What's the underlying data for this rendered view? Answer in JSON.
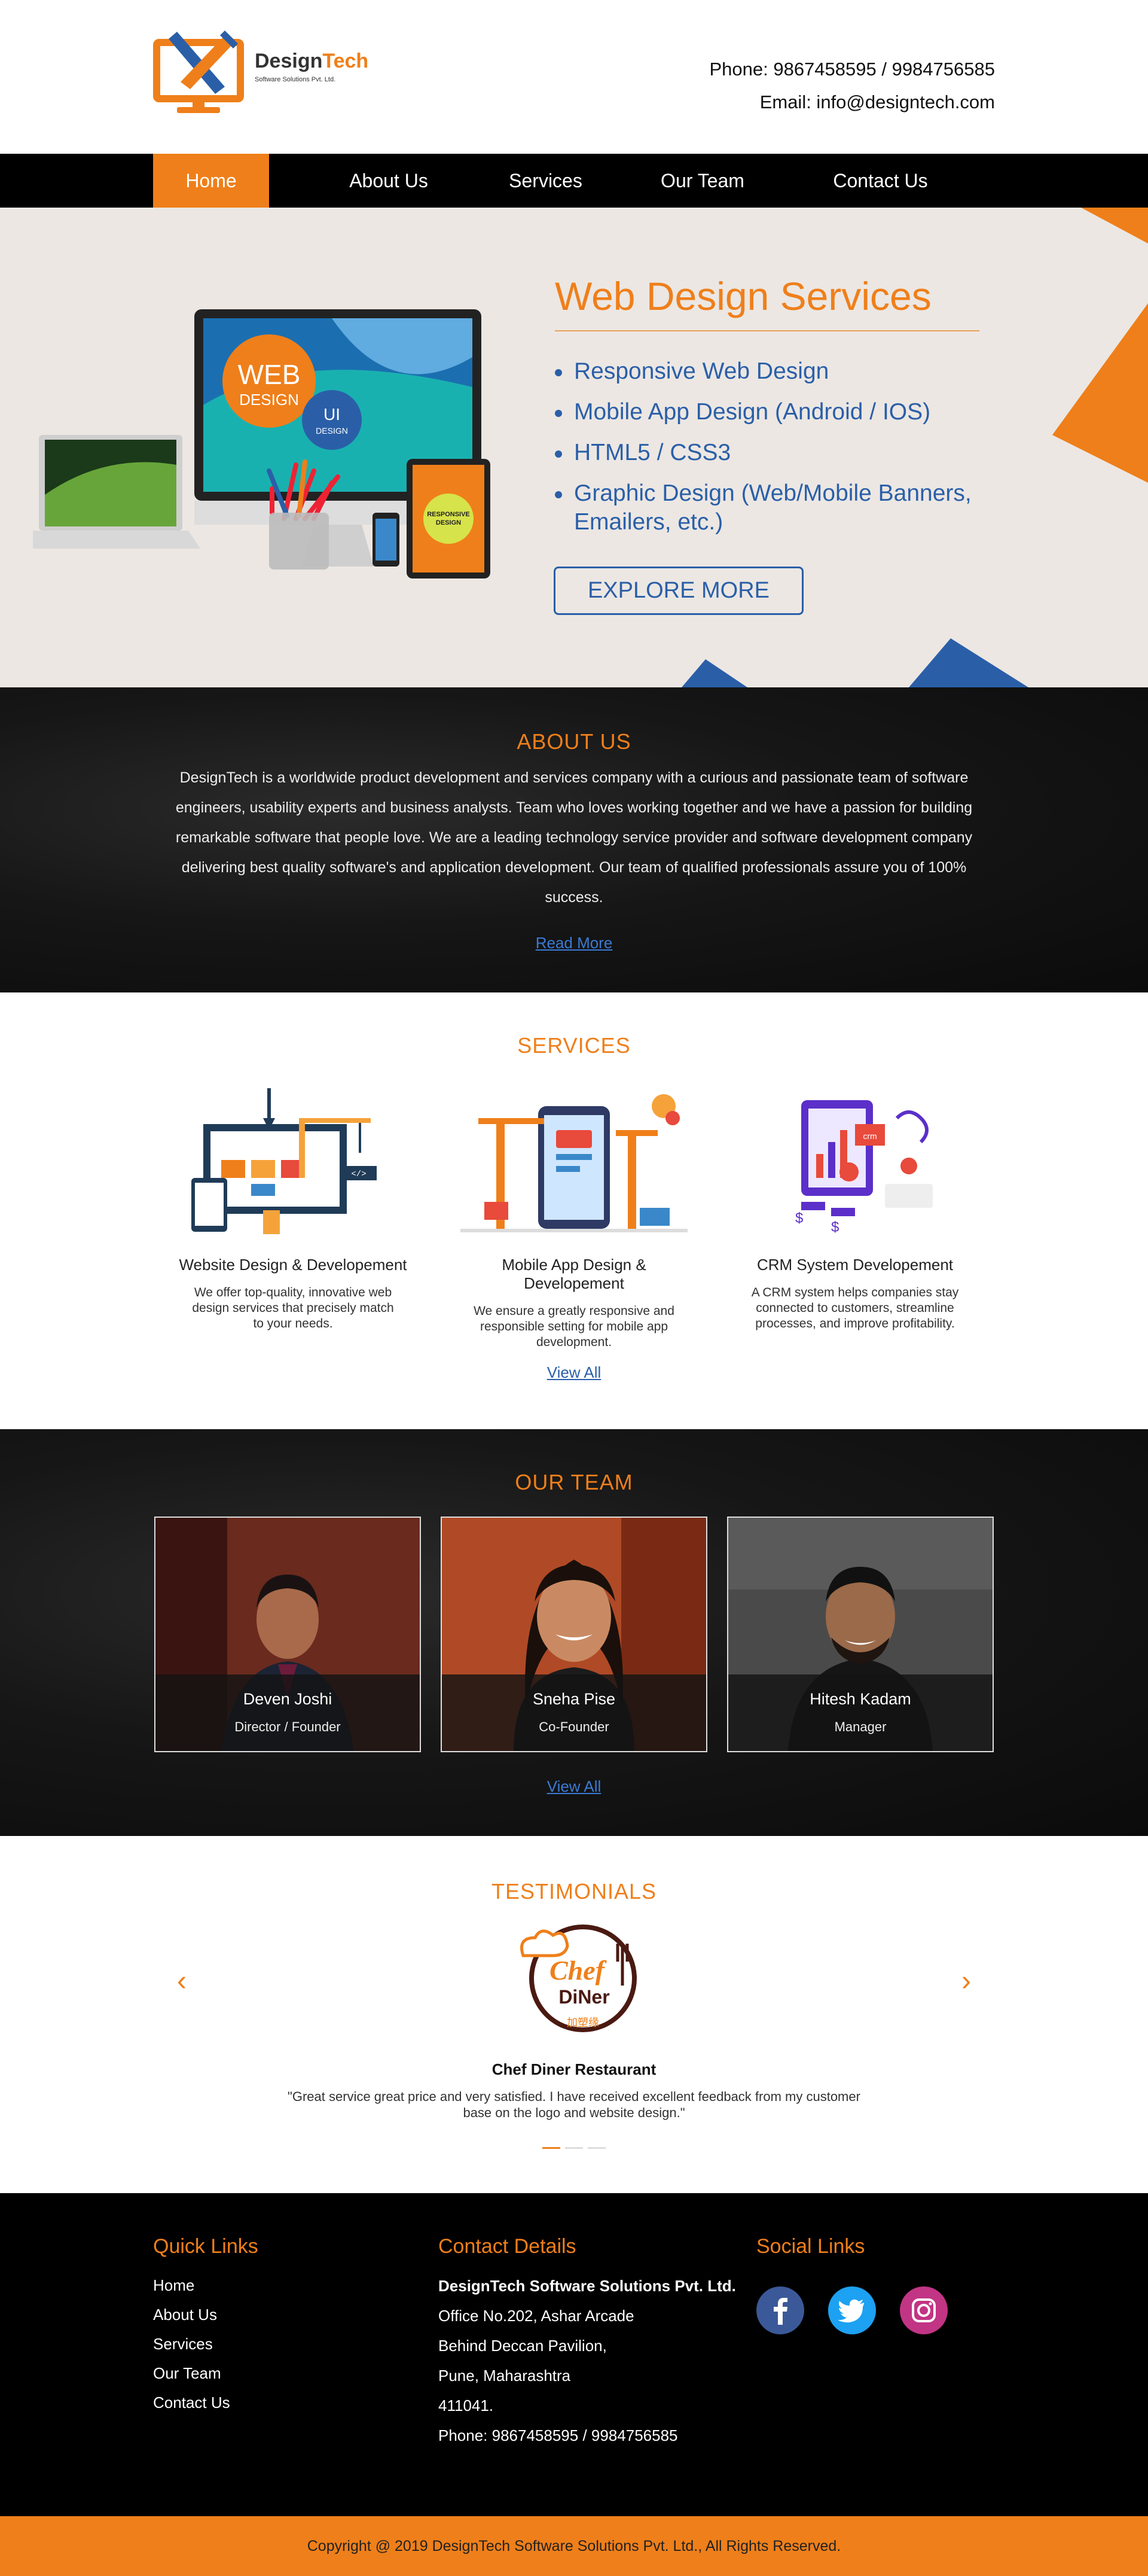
{
  "brand": {
    "name_part1": "Design",
    "name_part2": "Tech",
    "tagline": "Software Solutions Pvt. Ltd."
  },
  "header": {
    "phone": "Phone: 9867458595 / 9984756585",
    "email": "Email: info@designtech.com"
  },
  "nav": {
    "items": [
      "Home",
      "About Us",
      "Services",
      "Our Team",
      "Contact Us"
    ],
    "active": "Home"
  },
  "hero": {
    "title": "Web Design Services",
    "bullets": [
      "Responsive Web Design",
      "Mobile App Design (Android / IOS)",
      "HTML5 / CSS3",
      "Graphic Design (Web/Mobile Banners, Emailers, etc.)"
    ],
    "button": "EXPLORE MORE",
    "badge_web_1": "WEB",
    "badge_web_2": "DESIGN",
    "badge_ui_1": "UI",
    "badge_ui_2": "DESIGN",
    "badge_resp": "RESPONSIVE DESIGN"
  },
  "about": {
    "title": "ABOUT US",
    "text": "DesignTech is a worldwide product development and services company with a curious and passionate team of software engineers, usability experts and business analysts. Team who loves working together and we have a passion for building remarkable software that people love. We are a leading technology service provider and software development company delivering best quality software's and application development. Our team of qualified professionals assure you of 100% success.",
    "link": "Read More"
  },
  "services": {
    "title": "SERVICES",
    "items": [
      {
        "name": "Website Design & Developement",
        "desc": "We offer top-quality, innovative web design services that precisely match to your needs."
      },
      {
        "name": "Mobile App Design & Developement",
        "desc": "We ensure a greatly responsive and responsible setting for mobile app development."
      },
      {
        "name": "CRM System Developement",
        "desc": "A CRM system helps companies stay connected to customers, streamline processes, and improve profitability."
      }
    ],
    "link": "View All"
  },
  "team": {
    "title": "OUR TEAM",
    "members": [
      {
        "name": "Deven Joshi",
        "role": "Director / Founder"
      },
      {
        "name": "Sneha Pise",
        "role": "Co-Founder"
      },
      {
        "name": "Hitesh Kadam",
        "role": "Manager"
      }
    ],
    "link": "View All"
  },
  "testimonials": {
    "title": "TESTIMONIALS",
    "prev": "‹",
    "next": "›",
    "logo_line1": "Chef",
    "logo_line2": "DiNer",
    "logo_line3": "加塑缘",
    "name": "Chef Diner Restaurant",
    "quote": "\"Great service great price and very satisfied. I have received excellent feedback from my customer base on the logo and website design.\"",
    "active_slide": 1,
    "slide_count": 3
  },
  "footer": {
    "quick_title": "Quick Links",
    "quick_links": [
      "Home",
      "About Us",
      "Services",
      "Our Team",
      "Contact Us"
    ],
    "contact_title": "Contact Details",
    "company": "DesignTech Software Solutions Pvt. Ltd.",
    "address_lines": [
      "Office No.202, Ashar Arcade",
      "Behind Deccan Pavilion,",
      "Pune, Maharashtra",
      "411041."
    ],
    "phone": "Phone: 9867458595 / 9984756585",
    "social_title": "Social Links",
    "social": [
      "facebook-icon",
      "twitter-icon",
      "instagram-icon"
    ]
  },
  "copyright": "Copyright @ 2019 DesignTech Software Solutions Pvt. Ltd., All Rights Reserved.",
  "colors": {
    "accent": "#ef7f1a",
    "link_blue": "#2a5fa8",
    "dark": "#000000",
    "hero_bg": "#ece7e3"
  }
}
